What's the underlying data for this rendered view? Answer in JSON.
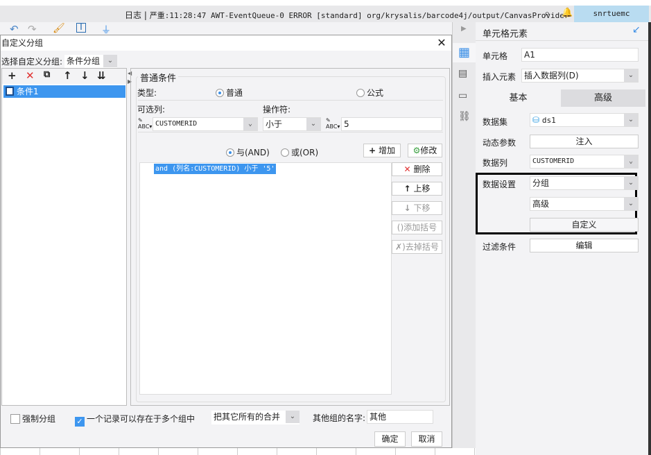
{
  "log": {
    "label": "日志",
    "separator": "|",
    "text": "严重:11:28:47 AWT-EventQueue-0 ERROR [standard] org/krysalis/barcode4j/output/CanvasProvider",
    "user": "snrtuemc"
  },
  "dialog": {
    "title": "自定义分组",
    "select_group_label": "选择自定义分组:",
    "select_group_value": "条件分组",
    "conditions": [
      {
        "label": "条件1"
      }
    ],
    "fieldset_title": "普通条件",
    "type_label": "类型:",
    "type_options": [
      "普通",
      "公式"
    ],
    "type_selected": "普通",
    "column_label": "可选列:",
    "column_value": "CUSTOMERID",
    "operator_label": "操作符:",
    "operator_value": "小于",
    "value": "5",
    "logic_options": [
      "与(AND)",
      "或(OR)"
    ],
    "logic_selected": "与(AND)",
    "add_label": "增加",
    "modify_label": "修改",
    "condition_items": [
      "and (列名:CUSTOMERID) 小于 '5'"
    ],
    "side_buttons": {
      "delete": "删除",
      "up": "上移",
      "down": "下移",
      "add_paren": "添加括号",
      "remove_paren": "去掉括号"
    },
    "force_group_label": "强制分组",
    "force_group_checked": false,
    "multi_group_label": "一个记录可以存在于多个组中",
    "multi_group_checked": true,
    "merge_value": "把其它所有的合并",
    "other_name_label": "其他组的名字:",
    "other_name_value": "其他",
    "ok": "确定",
    "cancel": "取消"
  },
  "panel": {
    "title": "单元格元素",
    "cell_label": "单元格",
    "cell_value": "A1",
    "insert_label": "插入元素",
    "insert_value": "插入数据列(D)",
    "tabs": [
      "基本",
      "高级"
    ],
    "active_tab": "基本",
    "dataset_label": "数据集",
    "dataset_value": "ds1",
    "param_label": "动态参数",
    "param_button": "注入",
    "column_label": "数据列",
    "column_value": "CUSTOMERID",
    "setting_label": "数据设置",
    "setting_value": "分组",
    "setting_mode": "高级",
    "custom_button": "自定义",
    "filter_label": "过滤条件",
    "filter_button": "编辑"
  },
  "colors": {
    "selection": "#3d96ef",
    "accent": "#3a8ee6",
    "highlight_box": "#000000"
  }
}
